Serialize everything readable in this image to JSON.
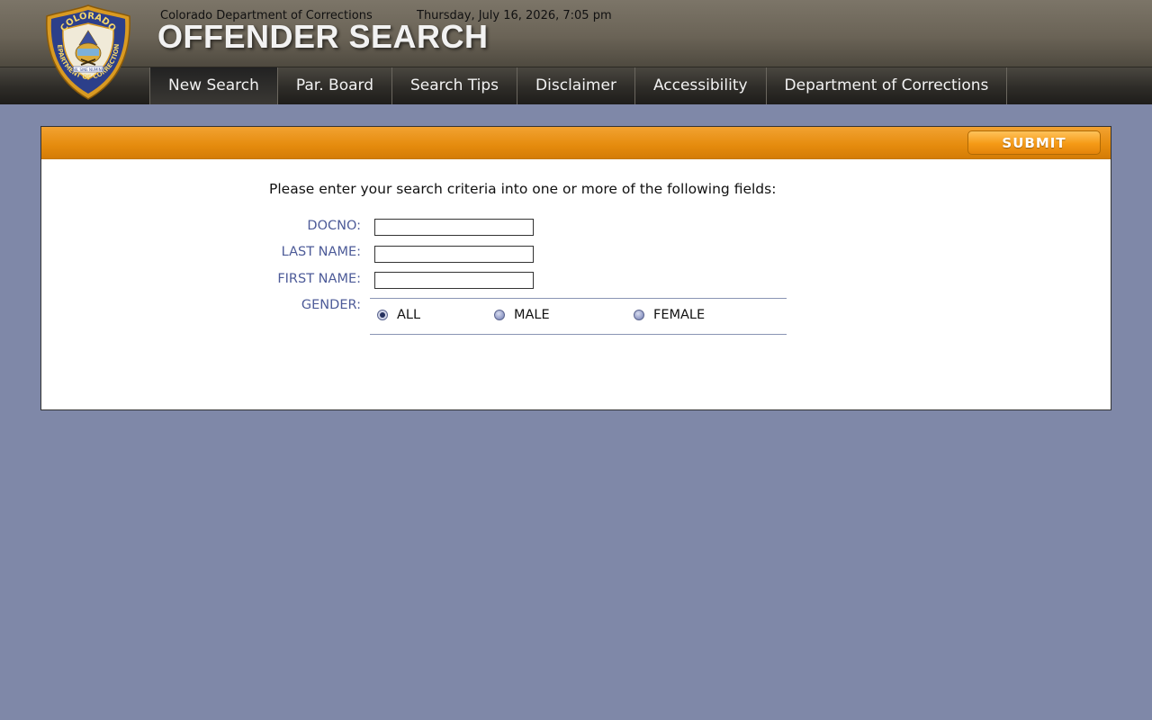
{
  "header": {
    "org_name": "Colorado Department of Corrections",
    "datetime": "Thursday, July 16, 2026, 7:05 pm",
    "title": "OFFENDER SEARCH",
    "logo": {
      "top_text": "COLORADO",
      "ring_text": "DEPARTMENT OF CORRECTIONS",
      "motto": "NIL SINE NUMINE"
    }
  },
  "nav": {
    "items": [
      {
        "label": "New Search",
        "active": true
      },
      {
        "label": "Par. Board"
      },
      {
        "label": "Search Tips"
      },
      {
        "label": "Disclaimer"
      },
      {
        "label": "Accessibility"
      },
      {
        "label": "Department of Corrections"
      }
    ]
  },
  "form": {
    "submit_label": "SUBMIT",
    "instructions": "Please enter your search criteria into one or more of the following fields:",
    "fields": {
      "docno": {
        "label": "DOCNO:",
        "value": ""
      },
      "last_name": {
        "label": "LAST NAME:",
        "value": ""
      },
      "first_name": {
        "label": "FIRST NAME:",
        "value": ""
      }
    },
    "gender": {
      "label": "GENDER:",
      "options": [
        "ALL",
        "MALE",
        "FEMALE"
      ],
      "selected": "ALL"
    }
  },
  "colors": {
    "page_background": "#7f88a8",
    "header": "#6a6356",
    "nav": "#2e2c28",
    "panel_bar": "#e58b0d",
    "label_text": "#4d5b98"
  }
}
